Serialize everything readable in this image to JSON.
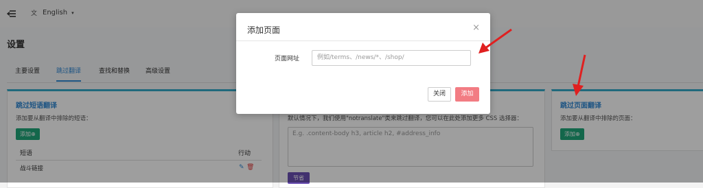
{
  "topbar": {
    "language": "English"
  },
  "page": {
    "title": "设置"
  },
  "tabs": [
    {
      "label": "主要设置"
    },
    {
      "label": "跳过翻译"
    },
    {
      "label": "查找和替换"
    },
    {
      "label": "高级设置"
    }
  ],
  "left_card": {
    "title": "跳过短语翻译",
    "desc": "添加要从翻译中排除的短语：",
    "add_button": "添加⊕",
    "col_phrase": "短语",
    "col_action": "行动",
    "rows": [
      {
        "phrase": "战斗链接"
      }
    ]
  },
  "middle_card": {
    "desc": "默认情况下，我们使用\"notranslate\"类来跳过翻译，您可以在此处添加更多 CSS 选择器：",
    "placeholder": "E.g. .content-body h3, article h2, #address_info",
    "save_button": "节省"
  },
  "right_card": {
    "title": "跳过页面翻译",
    "desc": "添加要从翻译中排除的页面：",
    "add_button": "添加⊕"
  },
  "modal": {
    "title": "添加页面",
    "close_glyph": "×",
    "label": "页面网址",
    "placeholder": "例如/terms、/news/*、/shop/",
    "close_button": "关闭",
    "add_button": "添加"
  },
  "colors": {
    "accent": "#2f88d4",
    "green": "#1fa67a",
    "add_pink": "#f27c83",
    "arrow": "#e02020"
  }
}
